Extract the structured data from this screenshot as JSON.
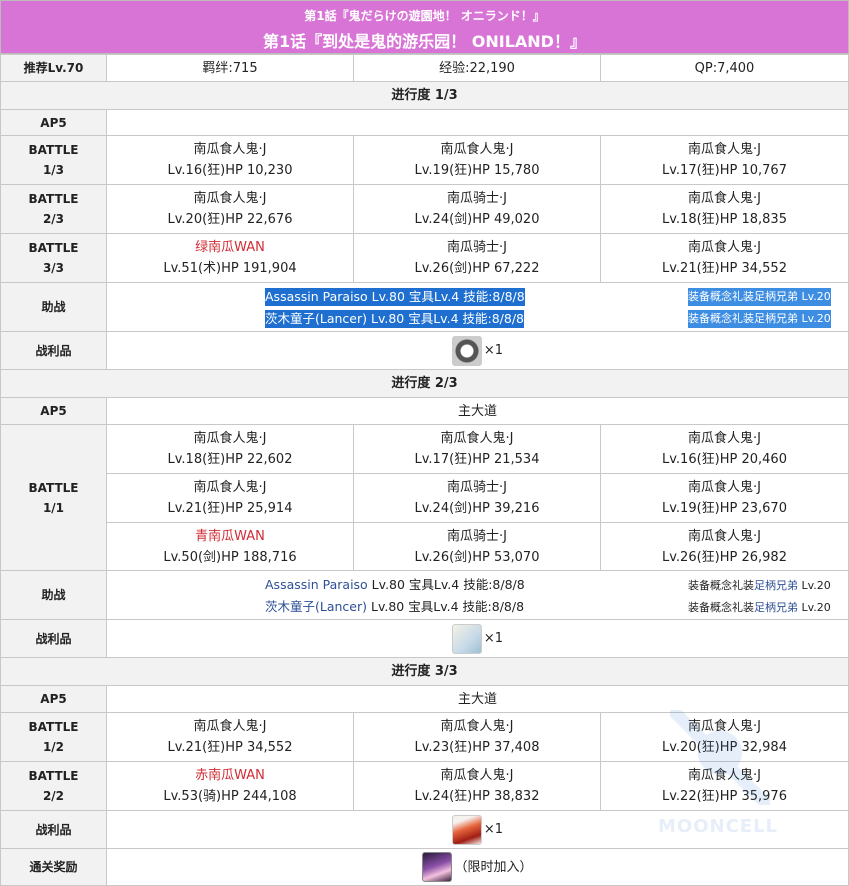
{
  "header": {
    "title_jp": "第1話『鬼だらけの遊園地！ オニランド！』",
    "title_cn": "第1话『到处是鬼的游乐园！ ONILAND！』"
  },
  "info": {
    "level": "推荐Lv.70",
    "bond": "羁绊:715",
    "exp": "经验:22,190",
    "qp": "QP:7,400"
  },
  "labels": {
    "ap": "AP5",
    "battle": "BATTLE",
    "support": "助战",
    "drops": "战利品",
    "clear_reward": "通关奖励",
    "main_road": "主大道"
  },
  "sections": [
    {
      "progress": "进行度 1/3",
      "battles": [
        {
          "no": "1/3",
          "enemies": [
            {
              "name": "南瓜食人鬼·J",
              "stat": "Lv.16(狂)HP 10,230"
            },
            {
              "name": "南瓜食人鬼·J",
              "stat": "Lv.19(狂)HP 15,780"
            },
            {
              "name": "南瓜食人鬼·J",
              "stat": "Lv.17(狂)HP 10,767"
            }
          ]
        },
        {
          "no": "2/3",
          "enemies": [
            {
              "name": "南瓜食人鬼·J",
              "stat": "Lv.20(狂)HP 22,676"
            },
            {
              "name": "南瓜骑士·J",
              "stat": "Lv.24(剑)HP 49,020"
            },
            {
              "name": "南瓜食人鬼·J",
              "stat": "Lv.18(狂)HP 18,835"
            }
          ]
        },
        {
          "no": "3/3",
          "enemies": [
            {
              "name": "绿南瓜WAN",
              "stat": "Lv.51(术)HP 191,904"
            },
            {
              "name": "南瓜骑士·J",
              "stat": "Lv.26(剑)HP 67,222"
            },
            {
              "name": "南瓜食人鬼·J",
              "stat": "Lv.21(狂)HP 34,552"
            }
          ]
        }
      ],
      "support": [
        {
          "servant": "Assassin Paraiso Lv.80 宝具Lv.4 技能:8/8/8",
          "ce": "装备概念礼装足柄兄弟 Lv.20"
        },
        {
          "servant": "茨木童子(Lancer) Lv.80 宝具Lv.4 技能:8/8/8",
          "ce": "装备概念礼装足柄兄弟 Lv.20"
        }
      ],
      "drop": {
        "icon": "ring-icon",
        "count": "×1"
      }
    },
    {
      "progress": "进行度 2/3",
      "battle_no": "1/1",
      "rows": [
        [
          {
            "name": "南瓜食人鬼·J",
            "stat": "Lv.18(狂)HP 22,602"
          },
          {
            "name": "南瓜食人鬼·J",
            "stat": "Lv.17(狂)HP 21,534"
          },
          {
            "name": "南瓜食人鬼·J",
            "stat": "Lv.16(狂)HP 20,460"
          }
        ],
        [
          {
            "name": "南瓜食人鬼·J",
            "stat": "Lv.21(狂)HP 25,914"
          },
          {
            "name": "南瓜骑士·J",
            "stat": "Lv.24(剑)HP 39,216"
          },
          {
            "name": "南瓜食人鬼·J",
            "stat": "Lv.19(狂)HP 23,670"
          }
        ],
        [
          {
            "name": "青南瓜WAN",
            "stat": "Lv.50(剑)HP 188,716"
          },
          {
            "name": "南瓜骑士·J",
            "stat": "Lv.26(剑)HP 53,070"
          },
          {
            "name": "南瓜食人鬼·J",
            "stat": "Lv.26(狂)HP 26,982"
          }
        ]
      ],
      "support": [
        {
          "servant_link": "Assassin Paraiso",
          "servant_rest": " Lv.80 宝具Lv.4 技能:8/8/8",
          "ce_pre": "装备概念礼装",
          "ce_link": "足柄兄弟",
          "ce_post": " Lv.20"
        },
        {
          "servant_link": "茨木童子(Lancer)",
          "servant_rest": " Lv.80 宝具Lv.4 技能:8/8/8",
          "ce_pre": "装备概念礼装",
          "ce_link": "足柄兄弟",
          "ce_post": " Lv.20"
        }
      ],
      "drop": {
        "icon": "paper-icon",
        "count": "×1"
      }
    },
    {
      "progress": "进行度 3/3",
      "battles": [
        {
          "no": "1/2",
          "enemies": [
            {
              "name": "南瓜食人鬼·J",
              "stat": "Lv.21(狂)HP 34,552"
            },
            {
              "name": "南瓜食人鬼·J",
              "stat": "Lv.23(狂)HP 37,408"
            },
            {
              "name": "南瓜食人鬼·J",
              "stat": "Lv.20(狂)HP 32,984"
            }
          ]
        },
        {
          "no": "2/2",
          "enemies": [
            {
              "name": "赤南瓜WAN",
              "stat": "Lv.53(骑)HP 244,108"
            },
            {
              "name": "南瓜食人鬼·J",
              "stat": "Lv.24(狂)HP 38,832"
            },
            {
              "name": "南瓜食人鬼·J",
              "stat": "Lv.22(狂)HP 35,976"
            }
          ]
        }
      ],
      "drop": {
        "icon": "fire-icon",
        "count": "×1"
      },
      "reward": {
        "icon": "card-icon",
        "text": "（限时加入）"
      }
    }
  ],
  "watermark": "MOONCELL",
  "colors": {
    "header": "#d874d6",
    "enemy_boss": "#d12c35",
    "link": "#2e4f97",
    "selection": "#1e6fd0"
  }
}
